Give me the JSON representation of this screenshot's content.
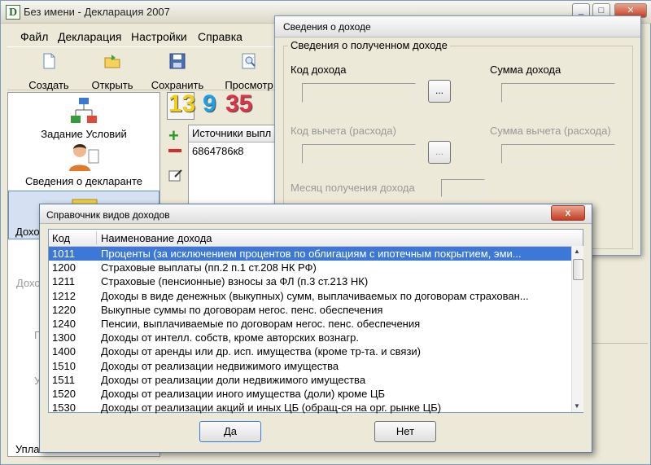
{
  "app": {
    "icon_letter": "D",
    "title": "Без имени - Декларация 2007",
    "icons": {
      "minimize": "minimize-icon",
      "maximize": "maximize-icon",
      "close": "close-icon"
    }
  },
  "menu": [
    "Файл",
    "Декларация",
    "Настройки",
    "Справка"
  ],
  "toolbar": [
    {
      "label": "Создать",
      "icon": "new-document-icon"
    },
    {
      "label": "Открыть",
      "icon": "open-folder-icon"
    },
    {
      "label": "Сохранить",
      "icon": "floppy-disk-icon"
    },
    {
      "label": "Просмотр",
      "icon": "preview-icon"
    }
  ],
  "left_panel": {
    "items": [
      {
        "label": "Задание Условий",
        "icon": "conditions-tree-icon"
      },
      {
        "label": "Сведения о декларанте",
        "icon": "person-icon"
      },
      {
        "label": "Дохо",
        "icon": "income-icon"
      }
    ],
    "hidden_fragments": [
      "Дохо",
      "П",
      "У"
    ],
    "bottom_label": "Упла"
  },
  "rates": [
    "13",
    "9",
    "35"
  ],
  "sources_grid": {
    "header": "Источники выпл",
    "value": "6864786к8"
  },
  "income_dialog": {
    "title": "Сведения о доходе",
    "group_title": "Сведения о полученном доходе",
    "code_label": "Код дохода",
    "sum_label": "Сумма дохода",
    "deduction_code_label": "Код вычета (расхода)",
    "deduction_sum_label": "Сумма вычета (расхода)",
    "month_label": "Месяц получения дохода",
    "browse_label": "..."
  },
  "ref_dialog": {
    "title": "Справочник видов доходов",
    "close_label": "x",
    "col_code": "Код",
    "col_name": "Наименование дохода",
    "rows": [
      {
        "code": "1011",
        "name": "Проценты (за исключением процентов по облигациям с ипотечным покрытием, эми..."
      },
      {
        "code": "1200",
        "name": "Страховые выплаты (пп.2 п.1 ст.208 НК РФ)"
      },
      {
        "code": "1211",
        "name": "Страховые (пенсионные) взносы за ФЛ (п.3 ст.213 НК)"
      },
      {
        "code": "1212",
        "name": "Доходы в виде денежных (выкупных) сумм, выплачиваемых по договорам страхован..."
      },
      {
        "code": "1220",
        "name": "Выкупные суммы по договорам негос. пенс. обеспечения"
      },
      {
        "code": "1240",
        "name": "Пенсии, выплачиваемые по договорам негос. пенс. обеспечения"
      },
      {
        "code": "1300",
        "name": "Доходы от интелл. собств, кроме авторских вознагр."
      },
      {
        "code": "1400",
        "name": "Доходы от аренды или др. исп. имущества (кроме тр-та. и связи)"
      },
      {
        "code": "1510",
        "name": "Доходы от реализации недвижимого имущества"
      },
      {
        "code": "1511",
        "name": "Доходы от реализации доли недвижимого имущества"
      },
      {
        "code": "1520",
        "name": "Доходы от реализации иного имущества (доли) кроме ЦБ"
      },
      {
        "code": "1530",
        "name": "Доходы от реализации акций и иных ЦБ (обращ-ся на орг. рынке ЦБ)"
      }
    ],
    "selected_index": 0,
    "ok_label": "Да",
    "cancel_label": "Нет"
  },
  "colors": {
    "selection": "#3c78d8",
    "rate_13": "#f2d017",
    "rate_9": "#1ea0e6",
    "rate_35": "#e0304a"
  }
}
